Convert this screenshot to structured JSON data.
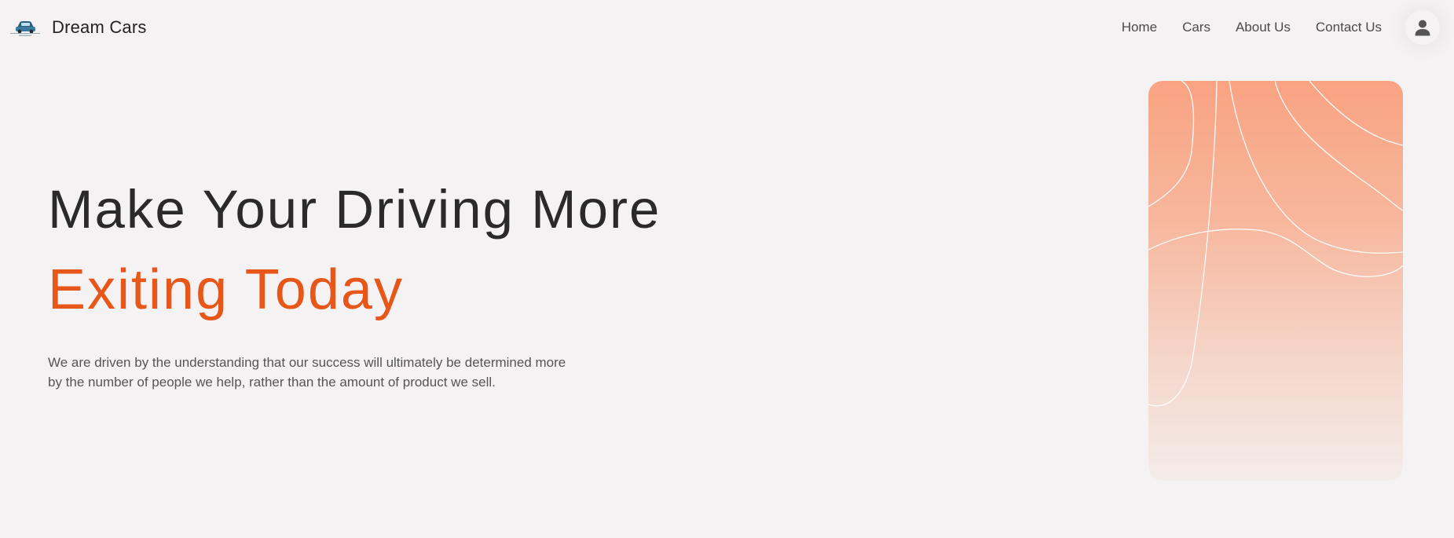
{
  "brand": {
    "name": "Dream Cars",
    "logo_icon": "car-logo-icon"
  },
  "nav": {
    "links": [
      {
        "label": "Home"
      },
      {
        "label": "Cars"
      },
      {
        "label": "About Us"
      },
      {
        "label": "Contact Us"
      }
    ],
    "user_icon": "user-icon"
  },
  "hero": {
    "headline_line1": "Make Your Driving More",
    "headline_line2": "Exiting Today",
    "description": "We are driven by the understanding that our success will ultimately be determined more by the number of people we help, rather than the amount of product we sell."
  },
  "colors": {
    "accent": "#e8571a",
    "background": "#f5f2f3",
    "card_gradient_top": "#f9a382",
    "card_gradient_bottom": "#f4ece9"
  }
}
